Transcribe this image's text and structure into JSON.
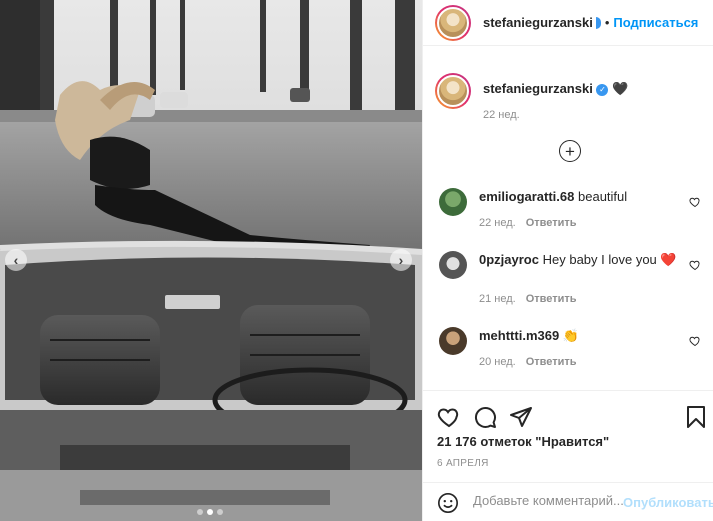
{
  "header": {
    "username": "stefaniegurzanski",
    "verified_icon": "verified-badge-icon",
    "separator": "•",
    "follow_label": "Подписаться"
  },
  "caption": {
    "username": "stefaniegurzanski",
    "text": "🖤",
    "time": "22 нед."
  },
  "load_more_icon": "plus-circle-icon",
  "comments": [
    {
      "username": "emiliogaratti.68",
      "text": "beautiful",
      "time": "22 нед.",
      "reply": "Ответить"
    },
    {
      "username": "0pzjayroc",
      "text": "Hey baby I love you ❤️",
      "text2": "❤️",
      "time": "21 нед.",
      "reply": "Ответить"
    },
    {
      "username": "mehttti.m369",
      "text": "👏",
      "time": "20 нед.",
      "reply": "Ответить"
    }
  ],
  "actions": {
    "like_icon": "heart-icon",
    "comment_icon": "comment-icon",
    "share_icon": "share-icon",
    "save_icon": "bookmark-icon",
    "likes": "21 176 отметок \"Нравится\"",
    "date": "6 АПРЕЛЯ"
  },
  "comment_box": {
    "emoji_icon": "emoji-icon",
    "placeholder": "Добавьте комментарий...",
    "post_label": "Опубликовать"
  },
  "carousel": {
    "dots": 3,
    "active_index": 1
  },
  "colors": {
    "accent": "#0095f6",
    "heart": "#ed4956",
    "text": "#262626",
    "muted": "#8e8e8e"
  }
}
